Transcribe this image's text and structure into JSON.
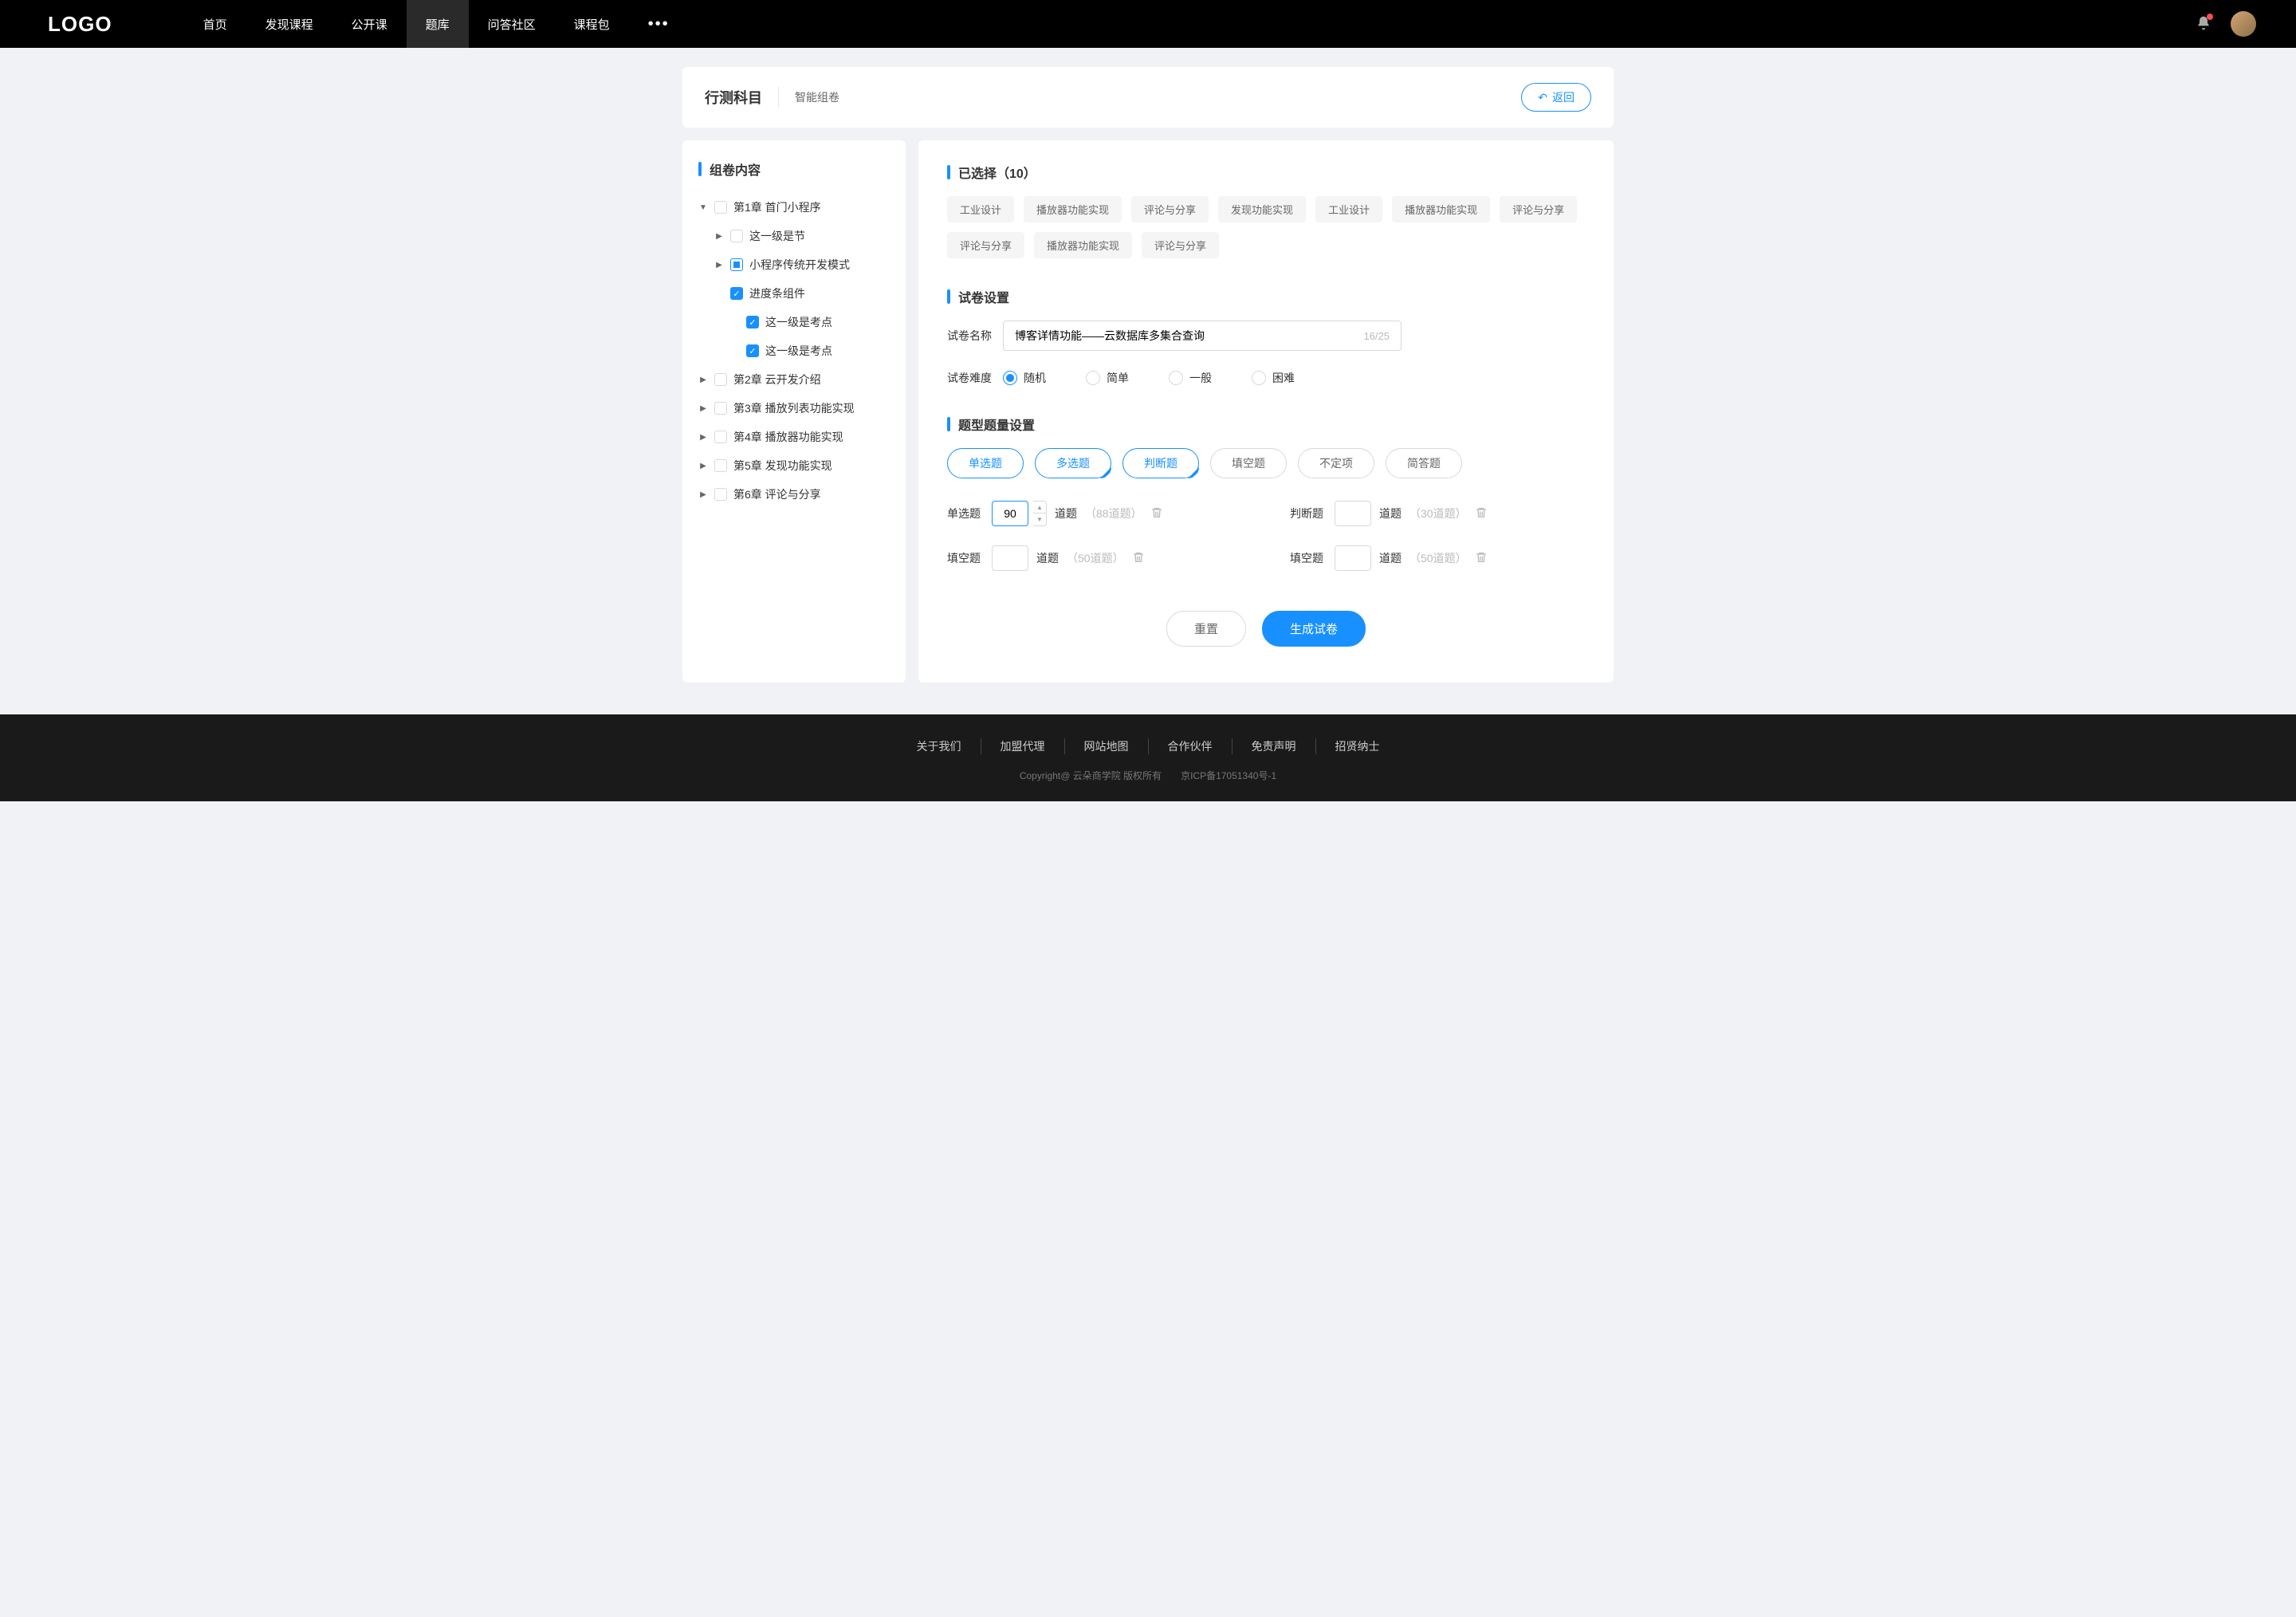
{
  "header": {
    "logo": "LOGO",
    "nav": [
      "首页",
      "发现课程",
      "公开课",
      "题库",
      "问答社区",
      "课程包"
    ],
    "active_index": 3
  },
  "page": {
    "title": "行测科目",
    "subtitle": "智能组卷",
    "back": "返回"
  },
  "sidebar": {
    "title": "组卷内容",
    "tree": [
      {
        "label": "第1章 首门小程序",
        "indent": 0,
        "caret": "down",
        "check": "empty"
      },
      {
        "label": "这一级是节",
        "indent": 1,
        "caret": "right",
        "check": "empty"
      },
      {
        "label": "小程序传统开发模式",
        "indent": 1,
        "caret": "right",
        "check": "partial"
      },
      {
        "label": "进度条组件",
        "indent": 1,
        "caret": "",
        "check": "checked"
      },
      {
        "label": "这一级是考点",
        "indent": 2,
        "caret": "",
        "check": "checked"
      },
      {
        "label": "这一级是考点",
        "indent": 2,
        "caret": "",
        "check": "checked"
      },
      {
        "label": "第2章 云开发介绍",
        "indent": 0,
        "caret": "right",
        "check": "empty"
      },
      {
        "label": "第3章 播放列表功能实现",
        "indent": 0,
        "caret": "right",
        "check": "empty"
      },
      {
        "label": "第4章 播放器功能实现",
        "indent": 0,
        "caret": "right",
        "check": "empty"
      },
      {
        "label": "第5章 发现功能实现",
        "indent": 0,
        "caret": "right",
        "check": "empty"
      },
      {
        "label": "第6章 评论与分享",
        "indent": 0,
        "caret": "right",
        "check": "empty"
      }
    ]
  },
  "selected": {
    "title": "已选择（10）",
    "tags": [
      "工业设计",
      "播放器功能实现",
      "评论与分享",
      "发现功能实现",
      "工业设计",
      "播放器功能实现",
      "评论与分享",
      "评论与分享",
      "播放器功能实现",
      "评论与分享"
    ]
  },
  "settings": {
    "title": "试卷设置",
    "name_label": "试卷名称",
    "name_value": "博客详情功能——云数据库多集合查询",
    "char_count": "16/25",
    "difficulty_label": "试卷难度",
    "difficulty_options": [
      "随机",
      "简单",
      "一般",
      "困难"
    ],
    "difficulty_selected": 0
  },
  "qtype": {
    "title": "题型题量设置",
    "pills": [
      {
        "label": "单选题",
        "selected": true,
        "corner": false
      },
      {
        "label": "多选题",
        "selected": true,
        "corner": true
      },
      {
        "label": "判断题",
        "selected": true,
        "corner": true
      },
      {
        "label": "填空题",
        "selected": false,
        "corner": false
      },
      {
        "label": "不定项",
        "selected": false,
        "corner": false
      },
      {
        "label": "简答题",
        "selected": false,
        "corner": false
      }
    ],
    "rows": [
      {
        "label": "单选题",
        "value": "90",
        "spinner": true,
        "unit": "道题",
        "hint": "（88道题）"
      },
      {
        "label": "判断题",
        "value": "",
        "spinner": false,
        "unit": "道题",
        "hint": "（30道题）"
      },
      {
        "label": "填空题",
        "value": "",
        "spinner": false,
        "unit": "道题",
        "hint": "（50道题）"
      },
      {
        "label": "填空题",
        "value": "",
        "spinner": false,
        "unit": "道题",
        "hint": "（50道题）"
      }
    ]
  },
  "actions": {
    "reset": "重置",
    "generate": "生成试卷"
  },
  "footer": {
    "links": [
      "关于我们",
      "加盟代理",
      "网站地图",
      "合作伙伴",
      "免责声明",
      "招贤纳士"
    ],
    "copyright_left": "Copyright@ 云朵商学院   版权所有",
    "copyright_right": "京ICP备17051340号-1"
  }
}
